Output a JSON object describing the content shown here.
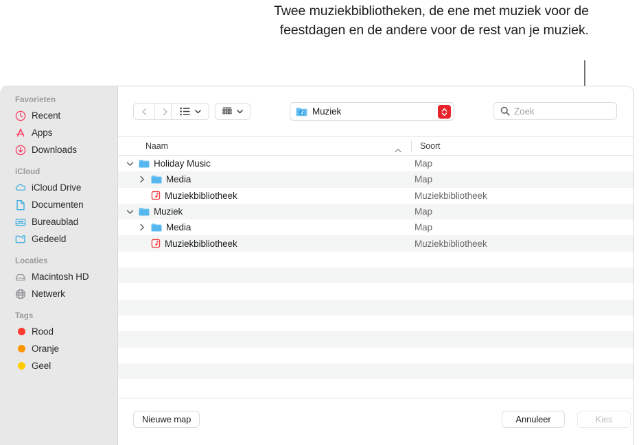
{
  "annotation": {
    "text": "Twee muziekbibliotheken, de ene met muziek voor de feestdagen en de andere voor de rest van je muziek."
  },
  "sidebar": {
    "groups": [
      {
        "title": "Favorieten",
        "items": [
          {
            "label": "Recent",
            "icon": "clock-icon",
            "color": "#ff375f"
          },
          {
            "label": "Apps",
            "icon": "app-store-icon",
            "color": "#ff375f"
          },
          {
            "label": "Downloads",
            "icon": "download-circle-icon",
            "color": "#ff375f"
          }
        ]
      },
      {
        "title": "iCloud",
        "items": [
          {
            "label": "iCloud Drive",
            "icon": "cloud-icon",
            "color": "#34aadc"
          },
          {
            "label": "Documenten",
            "icon": "document-icon",
            "color": "#34aadc"
          },
          {
            "label": "Bureaublad",
            "icon": "desktop-icon",
            "color": "#34aadc"
          },
          {
            "label": "Gedeeld",
            "icon": "shared-folder-icon",
            "color": "#34aadc"
          }
        ]
      },
      {
        "title": "Locaties",
        "items": [
          {
            "label": "Macintosh HD",
            "icon": "hard-disk-icon",
            "color": "#8e8e93"
          },
          {
            "label": "Netwerk",
            "icon": "globe-icon",
            "color": "#8e8e93"
          }
        ]
      },
      {
        "title": "Tags",
        "items": [
          {
            "label": "Rood",
            "icon": "tag-dot-icon",
            "color": "#ff3b30"
          },
          {
            "label": "Oranje",
            "icon": "tag-dot-icon",
            "color": "#ff9500"
          },
          {
            "label": "Geel",
            "icon": "tag-dot-icon",
            "color": "#ffcc00"
          }
        ]
      }
    ]
  },
  "toolbar": {
    "back_icon": "chevron-left-icon",
    "forward_icon": "chevron-right-icon",
    "view_icon": "list-view-icon",
    "group_icon": "group-by-icon",
    "dropdown_icon": "chevron-down-icon",
    "path_label": "Muziek",
    "path_icon": "music-folder-icon",
    "stepper_icon": "up-down-chevron-icon",
    "search_icon": "search-icon",
    "search_placeholder": "Zoek",
    "search_value": ""
  },
  "columns": {
    "name": "Naam",
    "kind": "Soort",
    "sort_icon": "chevron-up-icon"
  },
  "rows": [
    {
      "name": "Holiday Music",
      "kind": "Map",
      "indent": 0,
      "icon": "folder-icon",
      "disclosure": "expanded"
    },
    {
      "name": "Media",
      "kind": "Map",
      "indent": 1,
      "icon": "folder-icon",
      "disclosure": "collapsed"
    },
    {
      "name": "Muziekbibliotheek",
      "kind": "Muziekbibliotheek",
      "indent": 1,
      "icon": "music-library-icon",
      "disclosure": "none"
    },
    {
      "name": "Muziek",
      "kind": "Map",
      "indent": 0,
      "icon": "folder-icon",
      "disclosure": "expanded"
    },
    {
      "name": "Media",
      "kind": "Map",
      "indent": 1,
      "icon": "folder-icon",
      "disclosure": "collapsed"
    },
    {
      "name": "Muziekbibliotheek",
      "kind": "Muziekbibliotheek",
      "indent": 1,
      "icon": "music-library-icon",
      "disclosure": "none"
    }
  ],
  "empty_row_count": 8,
  "bottom": {
    "new_folder": "Nieuwe map",
    "cancel": "Annuleer",
    "choose": "Kies"
  }
}
